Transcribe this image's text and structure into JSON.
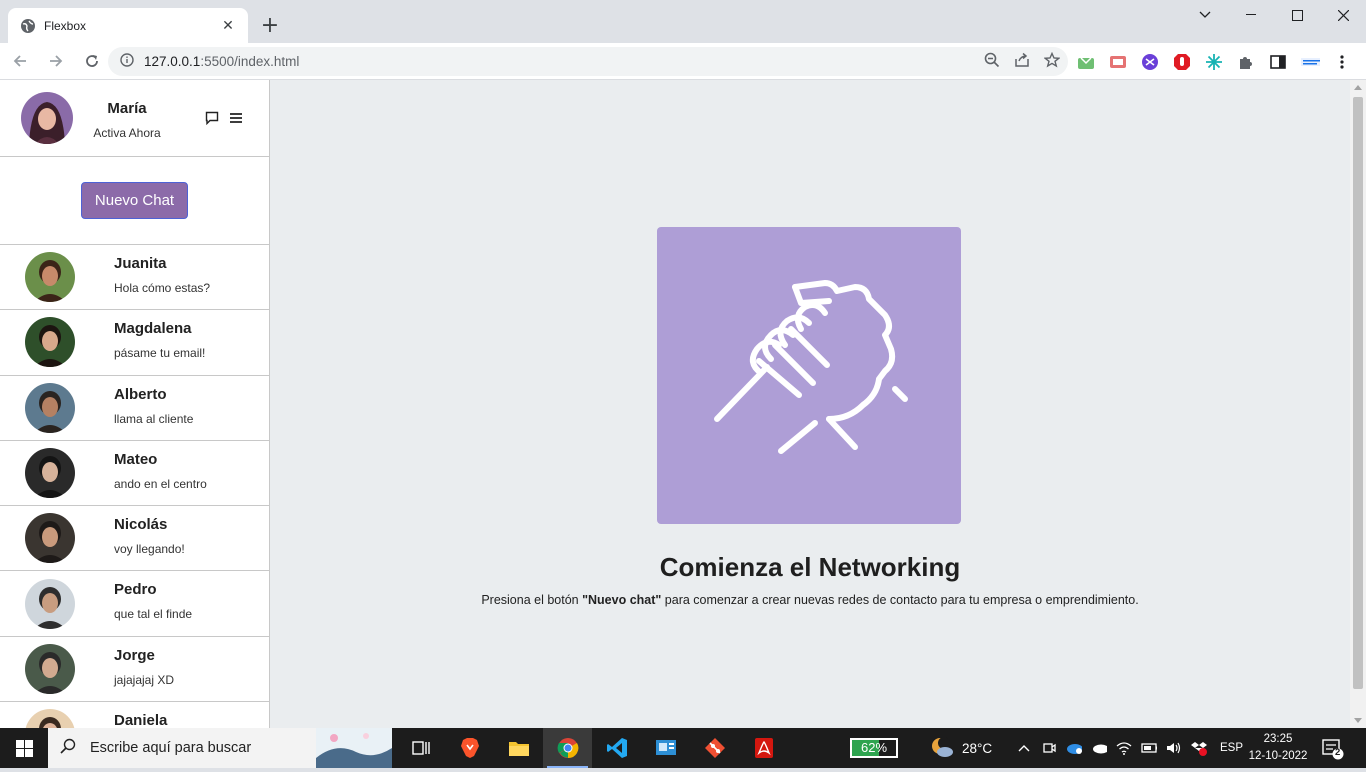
{
  "browser": {
    "tab_title": "Flexbox",
    "url_host": "127.0.0.1",
    "url_path": ":5500/index.html",
    "new_tab": "+"
  },
  "sidebar": {
    "profile": {
      "name": "María",
      "status": "Activa Ahora"
    },
    "new_chat_label": "Nuevo Chat",
    "chats": [
      {
        "name": "Juanita",
        "message": "Hola cómo estas?"
      },
      {
        "name": "Magdalena",
        "message": "pásame tu email!"
      },
      {
        "name": "Alberto",
        "message": "llama al cliente"
      },
      {
        "name": "Mateo",
        "message": "ando en el centro"
      },
      {
        "name": "Nicolás",
        "message": "voy llegando!"
      },
      {
        "name": "Pedro",
        "message": "que tal el finde"
      },
      {
        "name": "Jorge",
        "message": "jajajajaj XD"
      },
      {
        "name": "Daniela",
        "message": ""
      }
    ]
  },
  "main": {
    "title": "Comienza el Networking",
    "desc_before": "Presiona el botón ",
    "desc_bold": "\"Nuevo chat\"",
    "desc_after": " para comenzar a crear nuevas redes de contacto para tu empresa o emprendimiento.",
    "hero_icon": "handshake-icon",
    "hero_color": "#ae9ed6",
    "button_color": "#8c6ba9"
  },
  "taskbar": {
    "search_placeholder": "Escribe aquí para buscar",
    "battery": "62%",
    "battery_level": 0.62,
    "temperature": "28°C",
    "language": "ESP",
    "time": "23:25",
    "date": "12-10-2022",
    "notifications": "2"
  }
}
